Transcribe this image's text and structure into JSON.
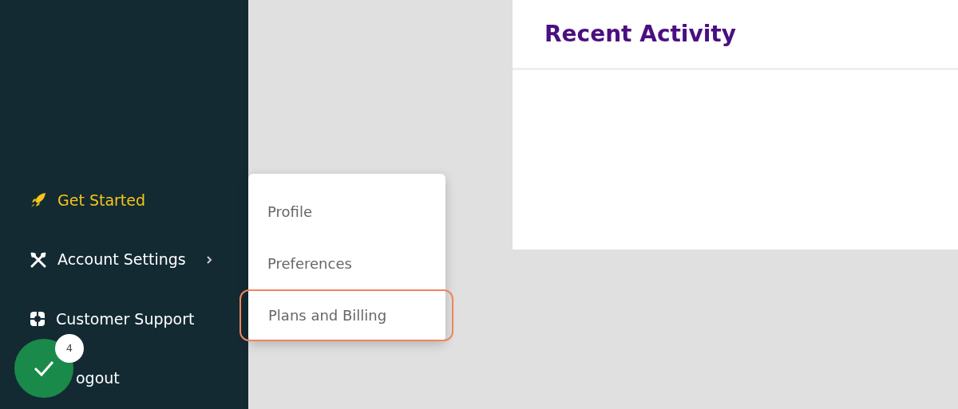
{
  "sidebar": {
    "items": [
      {
        "label": "Get Started",
        "selected": true,
        "has_submenu": false
      },
      {
        "label": "Account Settings",
        "selected": false,
        "has_submenu": true
      },
      {
        "label": "Customer Support",
        "selected": false,
        "has_submenu": false
      },
      {
        "label": "ogout",
        "selected": false,
        "has_submenu": false
      }
    ]
  },
  "submenu": {
    "items": [
      {
        "label": "Profile",
        "selected": false
      },
      {
        "label": "Preferences",
        "selected": false
      },
      {
        "label": "Plans and Billing",
        "selected": true
      }
    ]
  },
  "recent_activity": {
    "title": "Recent Activity"
  },
  "checklist_button": {
    "count": "4"
  }
}
